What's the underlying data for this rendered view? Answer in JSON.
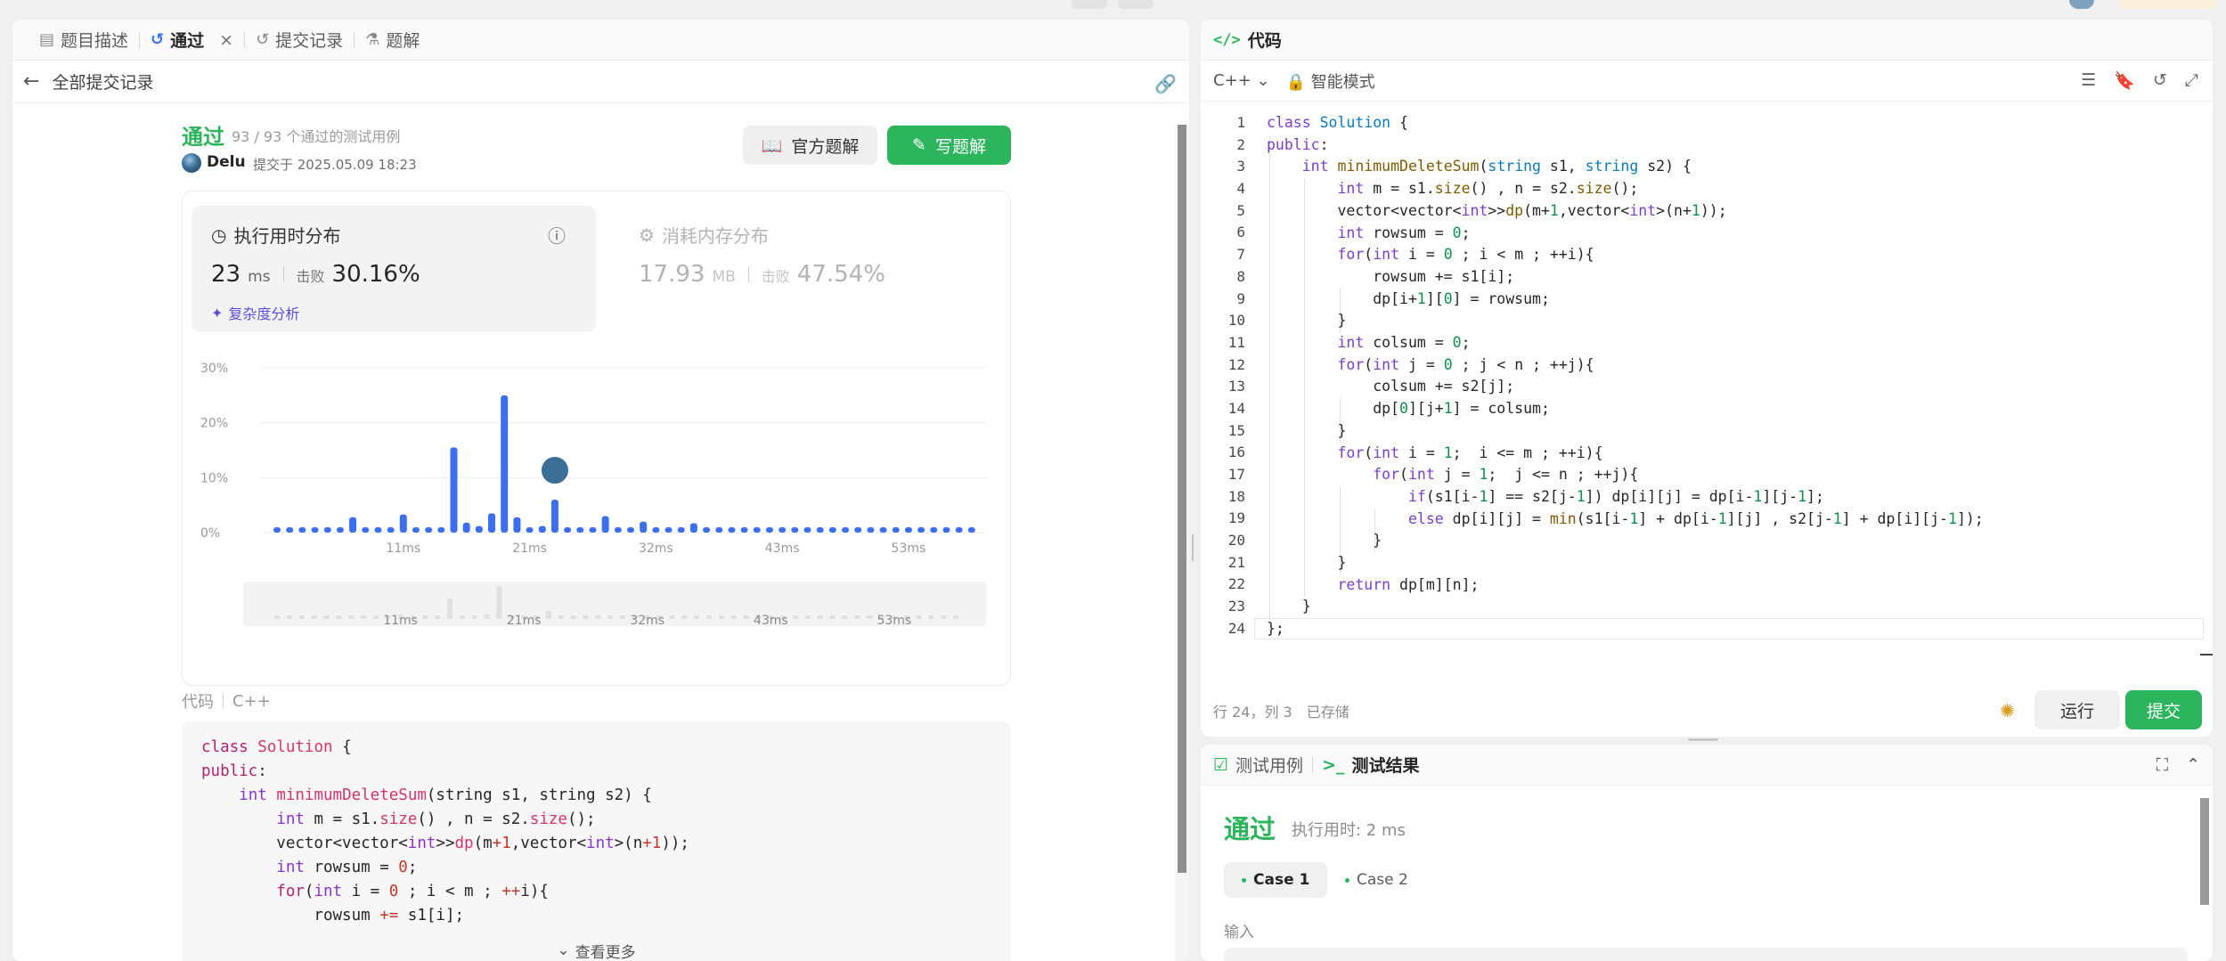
{
  "tabs": [
    {
      "label": "题目描述",
      "icon": "document-icon"
    },
    {
      "label": "通过",
      "icon": "history-icon",
      "active": true
    },
    {
      "label": "提交记录",
      "icon": "history-icon"
    },
    {
      "label": "题解",
      "icon": "flask-icon"
    }
  ],
  "close_glyph": "×",
  "back_label": "全部提交记录",
  "submission": {
    "status": "通过",
    "passed_text": "93 / 93 个通过的测试用例",
    "user": "Delu",
    "submitted_at": "提交于 2025.05.09 18:23"
  },
  "buttons": {
    "official": "官方题解",
    "write": "写题解"
  },
  "runtime": {
    "title": "执行用时分布",
    "value": "23",
    "unit": "ms",
    "beat_label": "击败",
    "beat_value": "30.16%",
    "complexity": "复杂度分析"
  },
  "memory": {
    "title": "消耗内存分布",
    "value": "17.93",
    "unit": "MB",
    "beat_label": "击败",
    "beat_value": "47.54%"
  },
  "chart_data": {
    "type": "bar",
    "x": [
      1,
      2,
      3,
      4,
      5,
      6,
      7,
      8,
      9,
      10,
      11,
      12,
      13,
      14,
      15,
      16,
      17,
      18,
      19,
      20,
      21,
      22,
      23,
      24,
      25,
      26,
      27,
      28,
      29,
      30,
      31,
      32,
      33,
      34,
      35,
      36,
      37,
      38,
      39,
      40,
      41,
      42,
      43,
      44,
      45,
      46,
      47,
      48,
      49,
      50,
      51,
      52,
      53,
      54,
      55,
      56
    ],
    "values": [
      0.6,
      0.6,
      0.6,
      0.6,
      0.6,
      0.6,
      2.8,
      0.6,
      0.6,
      0.6,
      3.3,
      0.6,
      0.6,
      0.6,
      15.5,
      1.8,
      1.2,
      3.5,
      25,
      2.8,
      0.6,
      1.2,
      6,
      0.6,
      0.6,
      0.6,
      3,
      0.6,
      0.6,
      2,
      0.6,
      0.6,
      0.6,
      1.7,
      0.6,
      0.6,
      0.6,
      0.6,
      0.6,
      0.6,
      0.6,
      0.6,
      0.6,
      0.6,
      0.6,
      0.6,
      0.6,
      0.6,
      0.6,
      0.6,
      0.6,
      0.6,
      0.6,
      0.6,
      0.6,
      0.6
    ],
    "highlight_x": 23,
    "yticks": [
      "30%",
      "20%",
      "10%",
      "0%"
    ],
    "ylim": [
      0,
      30
    ],
    "xticks": [
      {
        "label": "11ms",
        "x": 11
      },
      {
        "label": "21ms",
        "x": 21
      },
      {
        "label": "32ms",
        "x": 31
      },
      {
        "label": "43ms",
        "x": 41
      },
      {
        "label": "53ms",
        "x": 51
      }
    ],
    "grid": true
  },
  "code_section": {
    "label": "代码",
    "lang": "C++",
    "see_more": "查看更多"
  },
  "editor": {
    "title": "代码",
    "lang": "C++",
    "mode": "智能模式",
    "cursor": "行 24，列 3",
    "saved": "已存储",
    "run": "运行",
    "submit": "提交",
    "line_count": 24
  },
  "bottom": {
    "tab_cases": "测试用例",
    "tab_result": "测试结果",
    "result_status": "通过",
    "result_time": "执行用时: 2 ms",
    "case1": "Case 1",
    "case2": "Case 2",
    "input_label": "输入"
  },
  "colors": {
    "accent_green": "#2db55d",
    "bar_blue": "#3c6ef0",
    "accent_purple": "#5b4fd9"
  }
}
